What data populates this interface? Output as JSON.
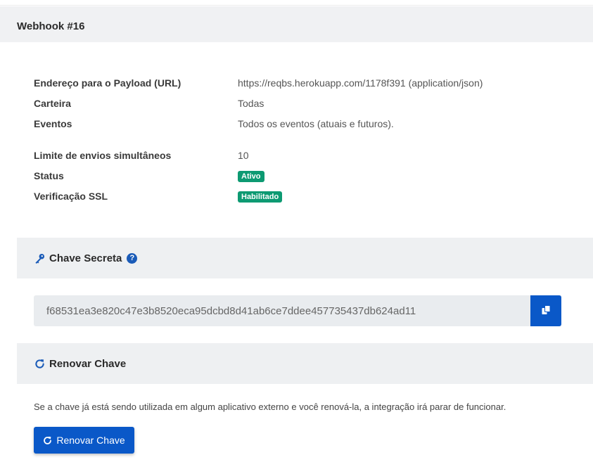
{
  "header": {
    "title": "Webhook #16"
  },
  "details": [
    {
      "label": "Endereço para o Payload (URL)",
      "value": "https://reqbs.herokuapp.com/1178f391 (application/json)"
    },
    {
      "label": "Carteira",
      "value": "Todas"
    },
    {
      "label": "Eventos",
      "value": "Todos os eventos (atuais e futuros)."
    },
    {
      "label": "Limite de envios simultâneos",
      "value": "10"
    },
    {
      "label": "Status",
      "badge": "Ativo"
    },
    {
      "label": "Verificação SSL",
      "badge": "Habilitado"
    }
  ],
  "secret": {
    "title": "Chave Secreta",
    "help": "?",
    "value": "f68531ea3e820c47e3b8520eca95dcbd8d41ab6ce7ddee457735437db624ad11"
  },
  "renew": {
    "title": "Renovar Chave",
    "warning": "Se a chave já está sendo utilizada em algum aplicativo externo e você renová-la, a integração irá parar de funcionar.",
    "button_label": "Renovar Chave"
  },
  "colors": {
    "primary": "#0a58c8",
    "badge": "#0d9a72",
    "section_bg": "#eef0f2",
    "input_bg": "#e9ecef"
  },
  "icons": {
    "secret": "key-icon",
    "help": "help-icon",
    "copy": "copy-icon",
    "renew": "refresh-icon"
  }
}
